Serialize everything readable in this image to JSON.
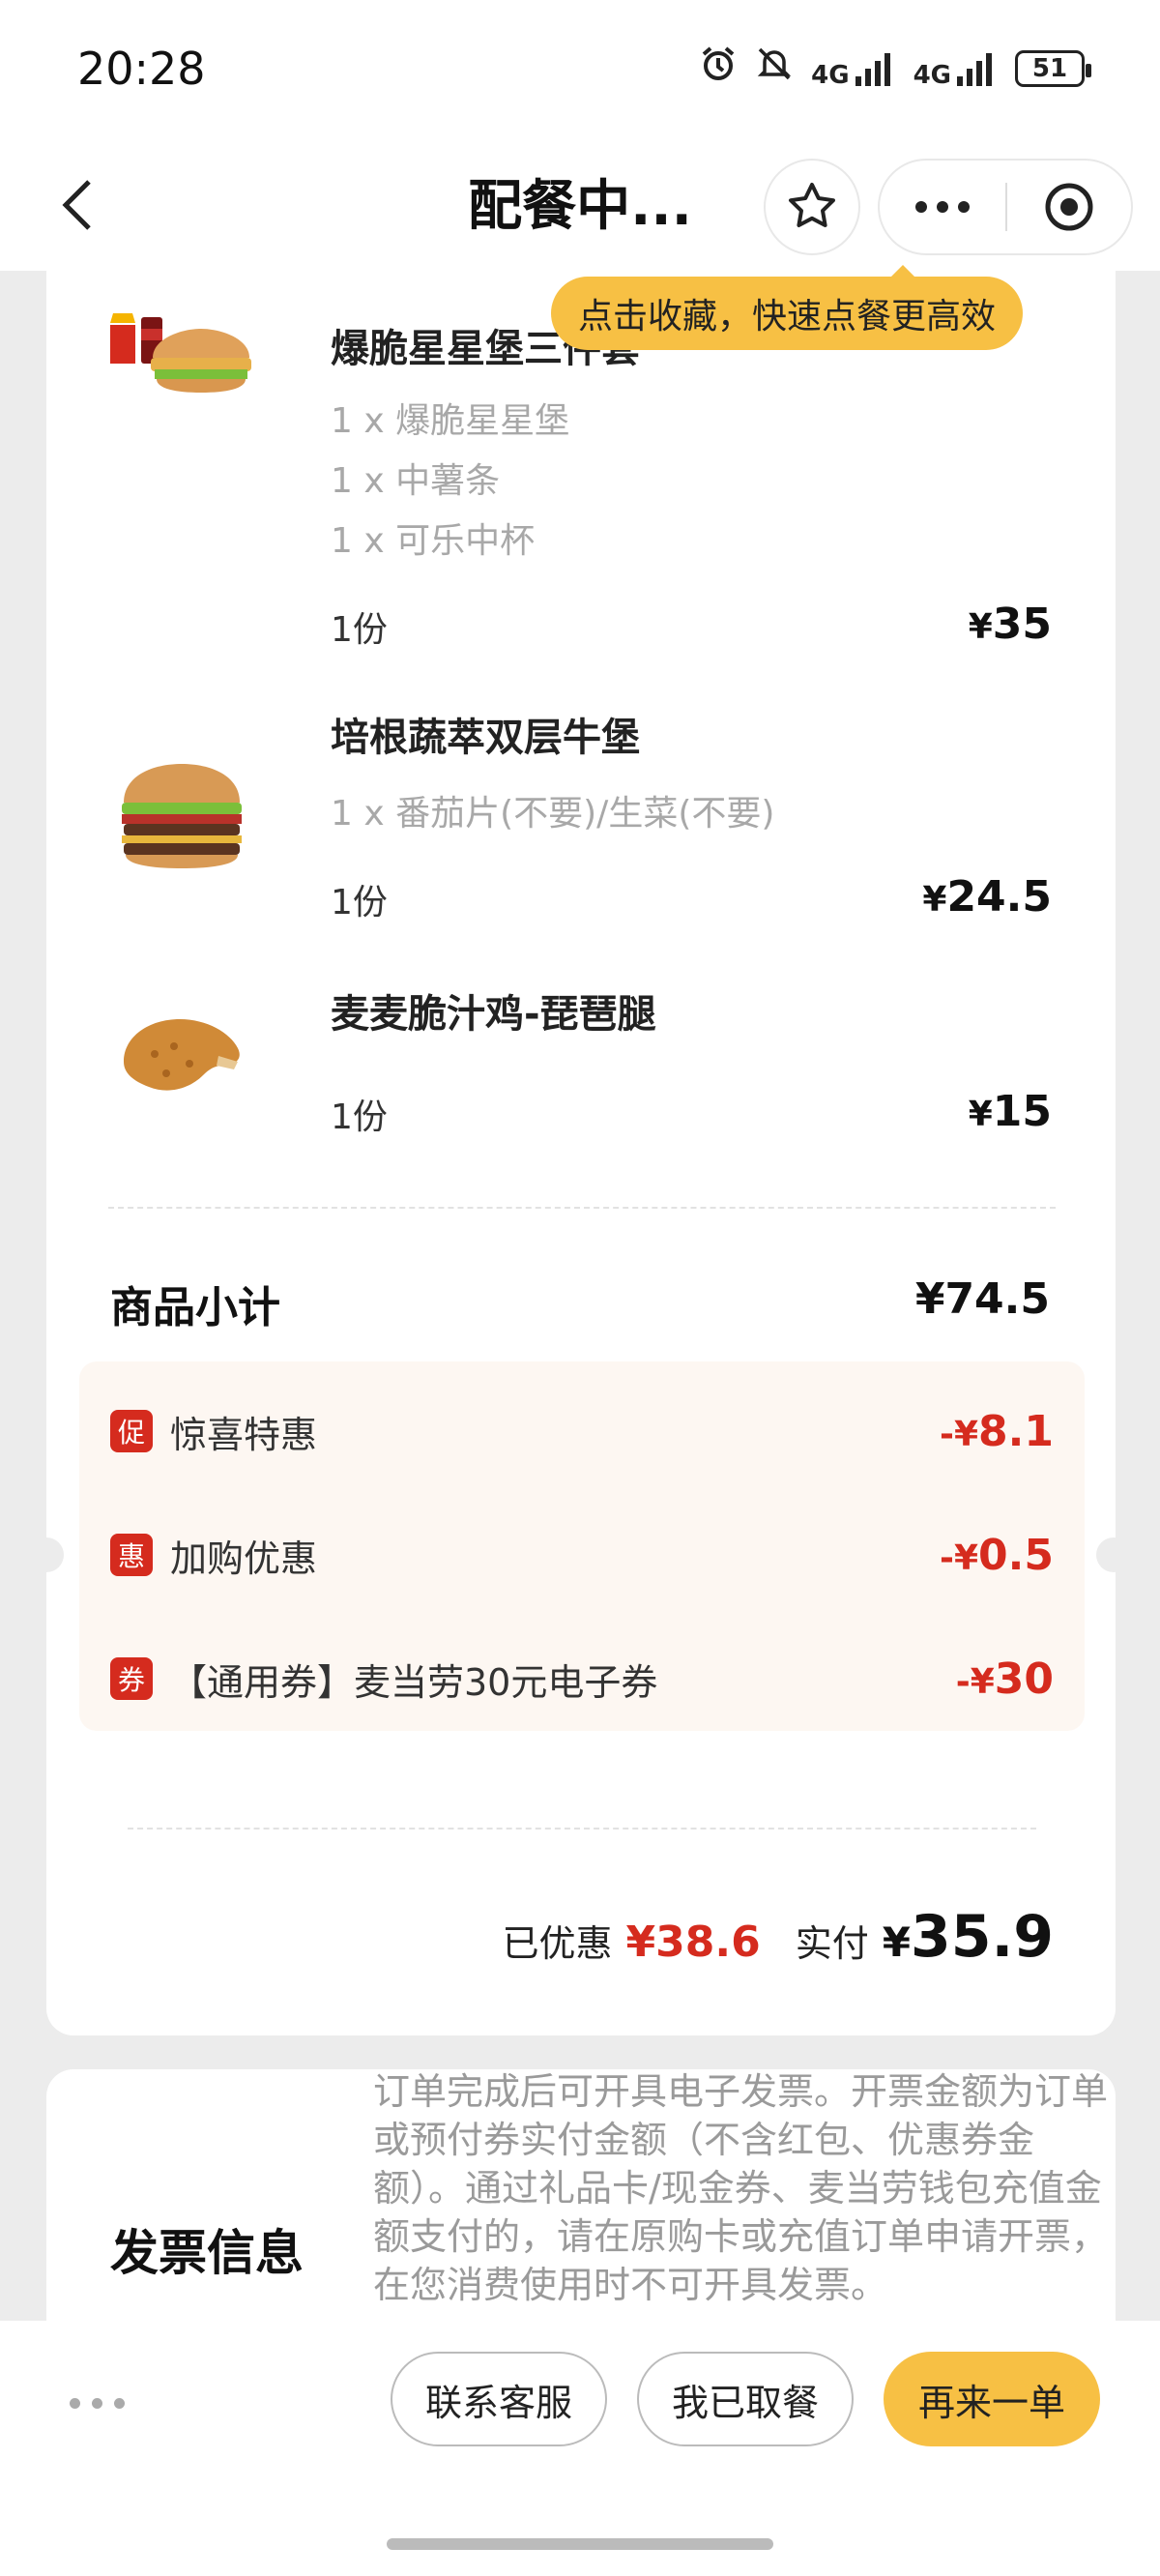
{
  "status_bar": {
    "time": "20:28",
    "network1": "4G",
    "network2": "4G",
    "battery": "51"
  },
  "nav": {
    "title": "配餐中..."
  },
  "tooltip": {
    "text": "点击收藏，快速点餐更高效"
  },
  "items": [
    {
      "name": "爆脆星星堡三件套",
      "subs": [
        "1 x 爆脆星星堡",
        "1 x 中薯条",
        "1 x 可乐中杯"
      ],
      "qty": "1份",
      "currency": "¥",
      "price": "35"
    },
    {
      "name": "培根蔬萃双层牛堡",
      "subs": [
        "1 x 番茄片(不要)/生菜(不要)"
      ],
      "qty": "1份",
      "currency": "¥",
      "price": "24.5"
    },
    {
      "name": "麦麦脆汁鸡-琵琶腿",
      "subs": [],
      "qty": "1份",
      "currency": "¥",
      "price": "15"
    }
  ],
  "subtotal": {
    "label": "商品小计",
    "currency": "¥",
    "value": "74.5"
  },
  "discounts": [
    {
      "badge": "促",
      "label": "惊喜特惠",
      "prefix": "-¥",
      "amount": "8.1"
    },
    {
      "badge": "惠",
      "label": "加购优惠",
      "prefix": "-¥",
      "amount": "0.5"
    },
    {
      "badge": "券",
      "label": "【通用券】麦当劳30元电子券",
      "prefix": "-¥",
      "amount": "30"
    }
  ],
  "total": {
    "saved_label": "已优惠",
    "saved_amount": "¥38.6",
    "paid_label": "实付",
    "currency": "¥",
    "paid_amount": "35.9"
  },
  "invoice": {
    "title": "发票信息",
    "text": "订单完成后可开具电子发票。开票金额为订单或预付券实付金额（不含红包、优惠券金额）。通过礼品卡/现金券、麦当劳钱包充值金额支付的，请在原购卡或充值订单申请开票，在您消费使用时不可开具发票。"
  },
  "actions": {
    "contact": "联系客服",
    "picked_up": "我已取餐",
    "reorder": "再来一单"
  },
  "colors": {
    "brand_yellow": "#f7c044",
    "discount_red": "#d52b1e"
  }
}
